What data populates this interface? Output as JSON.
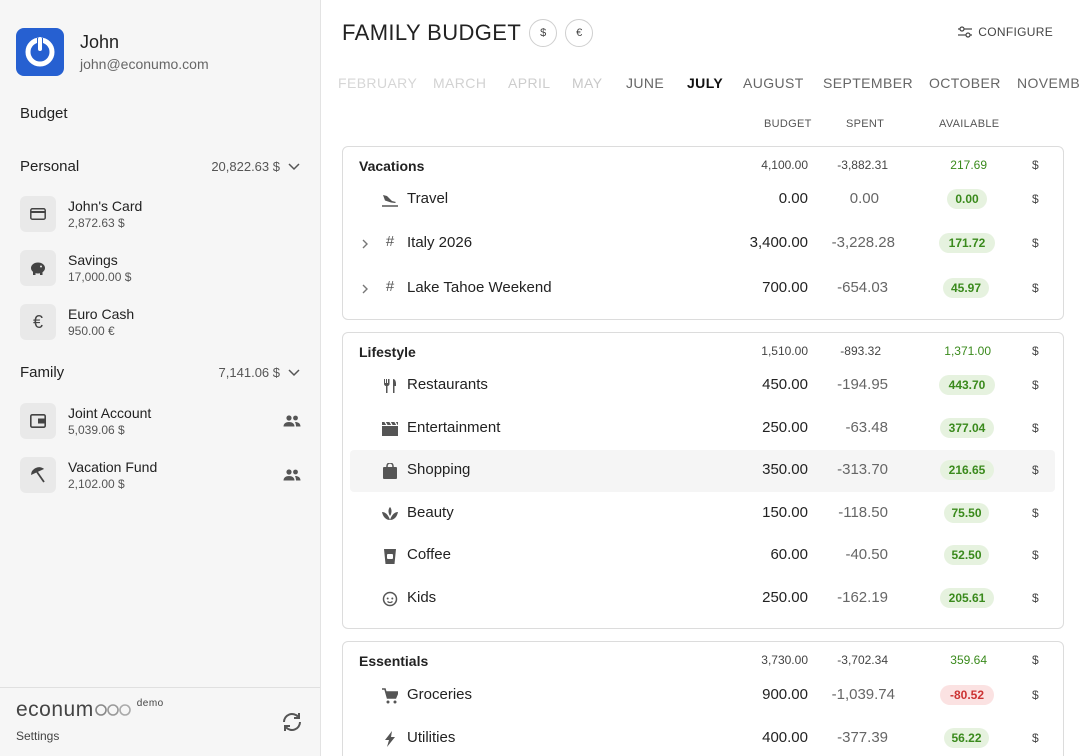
{
  "user": {
    "name": "John",
    "email": "john@econumo.com"
  },
  "sidebar": {
    "budget_label": "Budget",
    "groups": [
      {
        "name": "Personal",
        "total": "20,822.63 $",
        "accounts": [
          {
            "name": "John's Card",
            "balance": "2,872.63 $",
            "icon": "credit-card-icon",
            "shared": false
          },
          {
            "name": "Savings",
            "balance": "17,000.00 $",
            "icon": "piggy-bank-icon",
            "shared": false
          },
          {
            "name": "Euro Cash",
            "balance": "950.00 €",
            "icon": "euro-icon",
            "shared": false
          }
        ]
      },
      {
        "name": "Family",
        "total": "7,141.06 $",
        "accounts": [
          {
            "name": "Joint Account",
            "balance": "5,039.06 $",
            "icon": "wallet-icon",
            "shared": true
          },
          {
            "name": "Vacation Fund",
            "balance": "2,102.00 $",
            "icon": "beach-umbrella-icon",
            "shared": true
          }
        ]
      }
    ],
    "footer": {
      "logo": "econum",
      "logo_demo": "demo",
      "settings": "Settings"
    }
  },
  "main": {
    "title": "FAMILY BUDGET",
    "currency_buttons": [
      "$",
      "€"
    ],
    "configure": "CONFIGURE",
    "months": [
      "FEBRUARY",
      "MARCH",
      "APRIL",
      "MAY",
      "JUNE",
      "JULY",
      "AUGUST",
      "SEPTEMBER",
      "OCTOBER",
      "NOVEMBER"
    ],
    "active_month": "JULY",
    "columns": {
      "budget": "BUDGET",
      "spent": "SPENT",
      "available": "AVAILABLE"
    },
    "categories": [
      {
        "name": "Vacations",
        "budget": "4,100.00",
        "spent": "-3,882.31",
        "available": "217.69",
        "currency": "$",
        "items": [
          {
            "name": "Travel",
            "icon": "plane-landing-icon",
            "expandable": false,
            "budget": "0.00",
            "spent": "0.00",
            "available": "0.00",
            "status": "positive",
            "currency": "$"
          },
          {
            "name": "Italy 2026",
            "icon": "hashtag-icon",
            "expandable": true,
            "budget": "3,400.00",
            "spent": "-3,228.28",
            "available": "171.72",
            "status": "positive",
            "currency": "$"
          },
          {
            "name": "Lake Tahoe Weekend",
            "icon": "hashtag-icon",
            "expandable": true,
            "budget": "700.00",
            "spent": "-654.03",
            "available": "45.97",
            "status": "positive",
            "currency": "$"
          }
        ]
      },
      {
        "name": "Lifestyle",
        "budget": "1,510.00",
        "spent": "-893.32",
        "available": "1,371.00",
        "currency": "$",
        "items": [
          {
            "name": "Restaurants",
            "icon": "fork-knife-icon",
            "expandable": false,
            "budget": "450.00",
            "spent": "-194.95",
            "available": "443.70",
            "status": "positive",
            "currency": "$"
          },
          {
            "name": "Entertainment",
            "icon": "clapperboard-icon",
            "expandable": false,
            "budget": "250.00",
            "spent": "-63.48",
            "available": "377.04",
            "status": "positive",
            "currency": "$"
          },
          {
            "name": "Shopping",
            "icon": "shopping-bag-icon",
            "expandable": false,
            "budget": "350.00",
            "spent": "-313.70",
            "available": "216.65",
            "status": "positive",
            "currency": "$",
            "highlighted": true
          },
          {
            "name": "Beauty",
            "icon": "lotus-icon",
            "expandable": false,
            "budget": "150.00",
            "spent": "-118.50",
            "available": "75.50",
            "status": "positive",
            "currency": "$"
          },
          {
            "name": "Coffee",
            "icon": "coffee-cup-icon",
            "expandable": false,
            "budget": "60.00",
            "spent": "-40.50",
            "available": "52.50",
            "status": "positive",
            "currency": "$"
          },
          {
            "name": "Kids",
            "icon": "child-face-icon",
            "expandable": false,
            "budget": "250.00",
            "spent": "-162.19",
            "available": "205.61",
            "status": "positive",
            "currency": "$"
          }
        ]
      },
      {
        "name": "Essentials",
        "budget": "3,730.00",
        "spent": "-3,702.34",
        "available": "359.64",
        "currency": "$",
        "items": [
          {
            "name": "Groceries",
            "icon": "shopping-cart-icon",
            "expandable": false,
            "budget": "900.00",
            "spent": "-1,039.74",
            "available": "-80.52",
            "status": "negative",
            "currency": "$"
          },
          {
            "name": "Utilities",
            "icon": "lightning-icon",
            "expandable": false,
            "budget": "400.00",
            "spent": "-377.39",
            "available": "56.22",
            "status": "positive",
            "currency": "$"
          }
        ]
      }
    ]
  },
  "colors": {
    "accent": "#2660d1",
    "positive": "#3a8a1c",
    "positive_bg": "#e6f2df",
    "negative": "#cc3333",
    "negative_bg": "#fbe2e2"
  }
}
